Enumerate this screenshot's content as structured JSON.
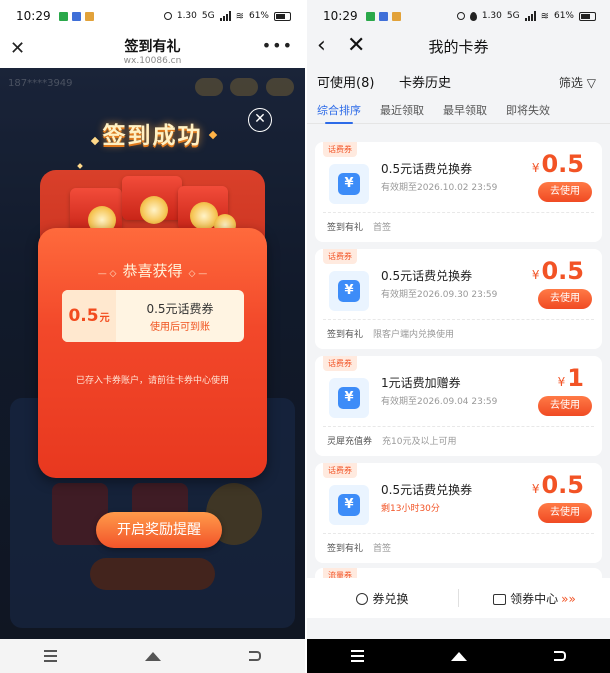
{
  "left": {
    "status": {
      "time": "10:29",
      "speed": "1.30",
      "network": "5G",
      "battery": "61%"
    },
    "header": {
      "title": "签到有礼",
      "subtitle": "wx.10086.cn"
    },
    "background": {
      "phone": "187****3949"
    },
    "popup": {
      "title": "签到成功",
      "heading": "恭喜获得",
      "coupon": {
        "amount": "0.5",
        "unit": "元",
        "name": "0.5元话费券",
        "note": "使用后可到账"
      },
      "note": "已存入卡券账户，请前往卡券中心使用",
      "button": "开启奖励提醒"
    }
  },
  "right": {
    "status": {
      "time": "10:29",
      "speed": "1.30",
      "network": "5G",
      "battery": "61%"
    },
    "header": {
      "title": "我的卡券"
    },
    "tabs": {
      "usable": "可使用(8)",
      "history": "卡券历史",
      "filter": "筛选"
    },
    "sorts": [
      "综合排序",
      "最近领取",
      "最早领取",
      "即将失效"
    ],
    "coupons": [
      {
        "tag": "话费券",
        "name": "0.5元话费兑换券",
        "expire": "有效期至2026.10.02 23:59",
        "currency": "¥",
        "price": "0.5",
        "button": "去使用",
        "source": "签到有礼",
        "rule": "首签",
        "urgent": false
      },
      {
        "tag": "话费券",
        "name": "0.5元话费兑换券",
        "expire": "有效期至2026.09.30 23:59",
        "currency": "¥",
        "price": "0.5",
        "button": "去使用",
        "source": "签到有礼",
        "rule": "限客户端内兑换使用",
        "urgent": false
      },
      {
        "tag": "话费券",
        "name": "1元话费加赠券",
        "expire": "有效期至2026.09.04 23:59",
        "currency": "¥",
        "price": "1",
        "button": "去使用",
        "source": "灵犀充值券",
        "rule": "充10元及以上可用",
        "urgent": false
      },
      {
        "tag": "话费券",
        "name": "0.5元话费兑换券",
        "expire": "剩13小时30分",
        "currency": "¥",
        "price": "0.5",
        "button": "去使用",
        "source": "签到有礼",
        "rule": "首签",
        "urgent": true
      }
    ],
    "partial_tag": "流量券",
    "bottom": {
      "exchange": "券兑换",
      "center": "领券中心"
    }
  }
}
